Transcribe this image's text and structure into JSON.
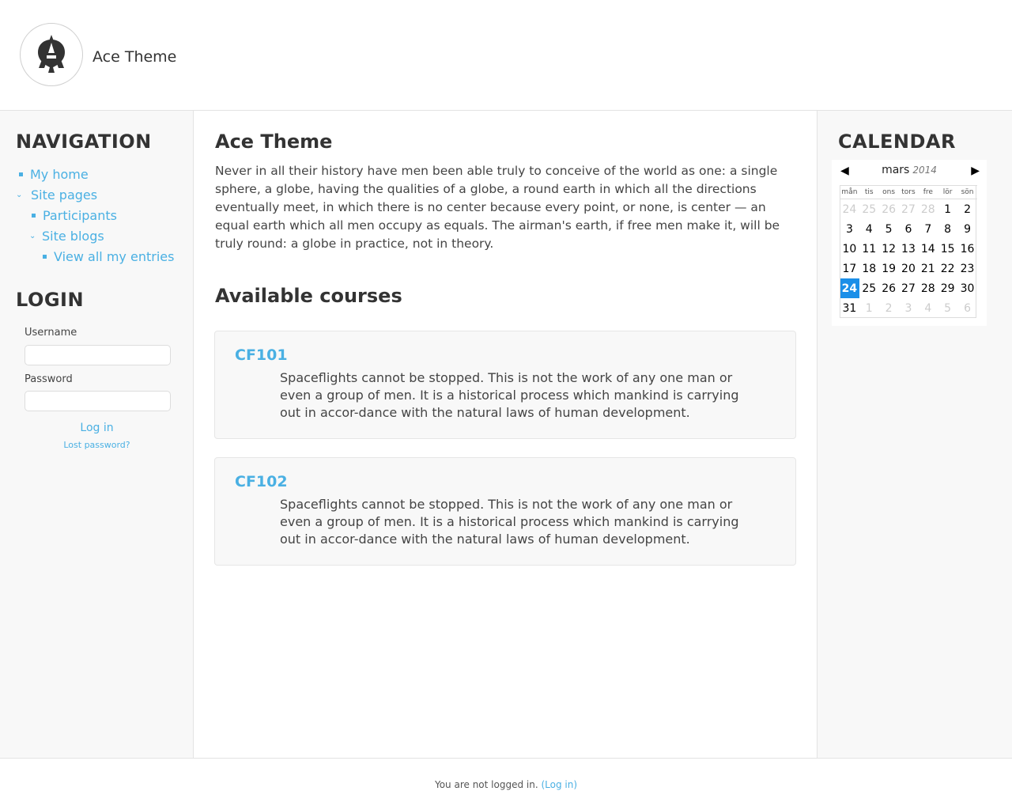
{
  "header": {
    "site_name": "Ace Theme",
    "logo_icon": "ace-spade-logo-icon"
  },
  "navigation": {
    "title": "NAVIGATION",
    "items": [
      {
        "label": "My home"
      },
      {
        "label": "Site pages"
      },
      {
        "label": "Participants"
      },
      {
        "label": "Site blogs"
      },
      {
        "label": "View all my entries"
      }
    ]
  },
  "login": {
    "title": "LOGIN",
    "username_label": "Username",
    "username_value": "",
    "password_label": "Password",
    "password_value": "",
    "login_button": "Log in",
    "lost_password": "Lost password?"
  },
  "main": {
    "heading": "Ace Theme",
    "intro": "Never in all their history have men been able truly to conceive of the world as one: a single sphere, a globe, having the qualities of a globe, a round earth in which all the directions eventually meet, in which there is no center because every point, or none, is center — an equal earth which all men occupy as equals. The airman's earth, if free men make it, will be truly round: a globe in practice, not in theory.",
    "courses_heading": "Available courses",
    "courses": [
      {
        "name": "CF101",
        "summary": "Spaceflights cannot be stopped. This is not the work of any one man or even a group of men. It is a historical process which mankind is carrying out in accor-dance with the natural laws of human development."
      },
      {
        "name": "CF102",
        "summary": "Spaceflights cannot be stopped. This is not the work of any one man or even a group of men. It is a historical process which mankind is carrying out in accor-dance with the natural laws of human development."
      }
    ]
  },
  "calendar": {
    "title": "CALENDAR",
    "month": "mars",
    "year": "2014",
    "prev_icon": "triangle-left-icon",
    "next_icon": "triangle-right-icon",
    "weekdays": [
      "mån",
      "tis",
      "ons",
      "tors",
      "fre",
      "lör",
      "sön"
    ],
    "weeks": [
      [
        "24",
        "25",
        "26",
        "27",
        "28",
        "1",
        "2"
      ],
      [
        "3",
        "4",
        "5",
        "6",
        "7",
        "8",
        "9"
      ],
      [
        "10",
        "11",
        "12",
        "13",
        "14",
        "15",
        "16"
      ],
      [
        "17",
        "18",
        "19",
        "20",
        "21",
        "22",
        "23"
      ],
      [
        "24",
        "25",
        "26",
        "27",
        "28",
        "29",
        "30"
      ],
      [
        "31",
        "1",
        "2",
        "3",
        "4",
        "5",
        "6"
      ]
    ],
    "today": "24",
    "today_color": "#1b8fe8"
  },
  "footer": {
    "text": "You are not logged in.",
    "link": "(Log in)"
  },
  "colors": {
    "accent": "#4ab0e3",
    "panel_bg": "#f8f8f8"
  }
}
